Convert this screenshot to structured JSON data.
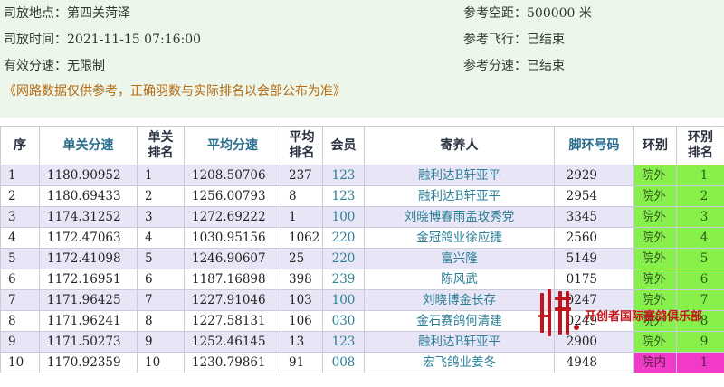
{
  "info": {
    "location_label": "司放地点：",
    "location": "第四关菏泽",
    "time_label": "司放时间：",
    "time": "2021-11-15 07:16:00",
    "speed_label": "有效分速：",
    "speed": "无限制",
    "distance_label": "参考空距：",
    "distance": "500000 米",
    "flight_label": "参考飞行：",
    "flight": "已结束",
    "ref_speed_label": "参考分速：",
    "ref_speed": "已结束"
  },
  "notice": "《网路数据仅供参考，正确羽数与实际排名以会部公布为准》",
  "table": {
    "headers": [
      "序",
      "单关分速",
      "单关\n排名",
      "平均分速",
      "平均\n排名",
      "会员",
      "寄养人",
      "脚环号码",
      "环别",
      "环别\n排名"
    ],
    "rows": [
      [
        "1",
        "1180.90952",
        "1",
        "1208.50706",
        "237",
        "123",
        "融利达B轩亚平",
        "2929",
        "院外",
        "1"
      ],
      [
        "2",
        "1180.69433",
        "2",
        "1256.00793",
        "8",
        "123",
        "融利达B轩亚平",
        "2954",
        "院外",
        "2"
      ],
      [
        "3",
        "1174.31252",
        "3",
        "1272.69222",
        "1",
        "100",
        "刘晓博春雨孟玫秀党",
        "3345",
        "院外",
        "3"
      ],
      [
        "4",
        "1172.47063",
        "4",
        "1030.95156",
        "1062",
        "220",
        "金冠鸽业徐应捷",
        "2560",
        "院外",
        "4"
      ],
      [
        "5",
        "1172.41098",
        "5",
        "1246.90607",
        "25",
        "220",
        "富兴隆",
        "5149",
        "院外",
        "5"
      ],
      [
        "6",
        "1172.16951",
        "6",
        "1187.16898",
        "398",
        "239",
        "陈风武",
        "0175",
        "院外",
        "6"
      ],
      [
        "7",
        "1171.96425",
        "7",
        "1227.91046",
        "103",
        "100",
        "刘晓博金长存",
        "0247",
        "院外",
        "7"
      ],
      [
        "8",
        "1171.96241",
        "8",
        "1227.58131",
        "106",
        "030",
        "金石赛鸽何清建",
        "0249",
        "院外",
        "8"
      ],
      [
        "9",
        "1171.50273",
        "9",
        "1252.46145",
        "13",
        "123",
        "融利达B轩亚平",
        "2900",
        "院外",
        "9"
      ],
      [
        "10",
        "1170.92359",
        "10",
        "1230.79861",
        "91",
        "008",
        "宏飞鸽业姜冬",
        "4948",
        "院内",
        "1"
      ]
    ]
  },
  "watermark": {
    "text": "开创者国际赛鸽俱乐部"
  },
  "colors": {
    "header_bg": "#edf6ea",
    "row_shaded": "#e8e6f6",
    "zone_out": "#88f04a",
    "zone_in": "#f23ac8",
    "link": "#2a7f96",
    "notice": "#b56a14",
    "watermark": "#c2141c"
  }
}
